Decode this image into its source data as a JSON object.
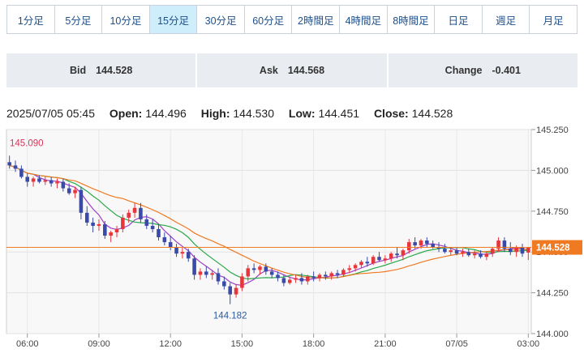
{
  "tabs": [
    {
      "label": "1分足",
      "active": false
    },
    {
      "label": "5分足",
      "active": false
    },
    {
      "label": "10分足",
      "active": false
    },
    {
      "label": "15分足",
      "active": true
    },
    {
      "label": "30分足",
      "active": false
    },
    {
      "label": "60分足",
      "active": false
    },
    {
      "label": "2時間足",
      "active": false
    },
    {
      "label": "4時間足",
      "active": false
    },
    {
      "label": "8時間足",
      "active": false
    },
    {
      "label": "日足",
      "active": false
    },
    {
      "label": "週足",
      "active": false
    },
    {
      "label": "月足",
      "active": false
    }
  ],
  "quote": {
    "bid_label": "Bid",
    "bid_value": "144.528",
    "ask_label": "Ask",
    "ask_value": "144.568",
    "change_label": "Change",
    "change_value": "-0.401"
  },
  "ohlc": {
    "datetime": "2025/07/05 05:45",
    "open_label": "Open:",
    "open": "144.496",
    "high_label": "High:",
    "high": "144.530",
    "low_label": "Low:",
    "low": "144.451",
    "close_label": "Close:",
    "close": "144.528"
  },
  "colors": {
    "up": "#e8353b",
    "down": "#3a4aa8",
    "ma_short": "#a03cc8",
    "ma_mid": "#2aa84a",
    "ma_long": "#f07a22",
    "price_line": "#f07a22",
    "high_label": "#d8335a",
    "low_label": "#2b5a9a"
  },
  "chart_data": {
    "type": "candlestick",
    "ylim": [
      144.0,
      145.25
    ],
    "y_ticks": [
      "145.250",
      "145.000",
      "144.750",
      "144.500",
      "144.250",
      "144.000"
    ],
    "x_ticks": [
      "06:00",
      "09:00",
      "12:00",
      "15:00",
      "18:00",
      "21:00",
      "07/05",
      "03:00"
    ],
    "high_annotation": "145.090",
    "low_annotation": "144.182",
    "current_price": "144.528",
    "grid": true,
    "ohlc": [
      [
        145.05,
        145.09,
        145.01,
        145.03
      ],
      [
        145.03,
        145.06,
        144.99,
        145.01
      ],
      [
        145.01,
        145.03,
        144.95,
        144.96
      ],
      [
        144.96,
        144.98,
        144.9,
        144.93
      ],
      [
        144.93,
        144.96,
        144.9,
        144.95
      ],
      [
        144.95,
        144.97,
        144.92,
        144.93
      ],
      [
        144.93,
        144.96,
        144.91,
        144.94
      ],
      [
        144.94,
        144.96,
        144.9,
        144.92
      ],
      [
        144.92,
        144.95,
        144.89,
        144.93
      ],
      [
        144.93,
        144.95,
        144.87,
        144.89
      ],
      [
        144.89,
        144.92,
        144.85,
        144.86
      ],
      [
        144.86,
        144.9,
        144.83,
        144.88
      ],
      [
        144.88,
        144.9,
        144.7,
        144.74
      ],
      [
        144.74,
        144.78,
        144.66,
        144.68
      ],
      [
        144.68,
        144.71,
        144.62,
        144.66
      ],
      [
        144.66,
        144.7,
        144.63,
        144.67
      ],
      [
        144.67,
        144.69,
        144.58,
        144.6
      ],
      [
        144.6,
        144.63,
        144.56,
        144.62
      ],
      [
        144.62,
        144.66,
        144.59,
        144.64
      ],
      [
        144.64,
        144.73,
        144.62,
        144.71
      ],
      [
        144.71,
        144.76,
        144.68,
        144.74
      ],
      [
        144.74,
        144.8,
        144.71,
        144.77
      ],
      [
        144.77,
        144.8,
        144.68,
        144.7
      ],
      [
        144.7,
        144.73,
        144.64,
        144.66
      ],
      [
        144.66,
        144.7,
        144.62,
        144.64
      ],
      [
        144.64,
        144.67,
        144.57,
        144.59
      ],
      [
        144.59,
        144.62,
        144.54,
        144.56
      ],
      [
        144.56,
        144.6,
        144.51,
        144.53
      ],
      [
        144.53,
        144.55,
        144.47,
        144.49
      ],
      [
        144.49,
        144.53,
        144.46,
        144.5
      ],
      [
        144.5,
        144.52,
        144.44,
        144.46
      ],
      [
        144.46,
        144.48,
        144.33,
        144.36
      ],
      [
        144.36,
        144.4,
        144.33,
        144.38
      ],
      [
        144.38,
        144.41,
        144.34,
        144.36
      ],
      [
        144.36,
        144.39,
        144.33,
        144.37
      ],
      [
        144.37,
        144.4,
        144.3,
        144.32
      ],
      [
        144.32,
        144.35,
        144.27,
        144.29
      ],
      [
        144.29,
        144.31,
        144.18,
        144.24
      ],
      [
        144.24,
        144.3,
        144.22,
        144.28
      ],
      [
        144.28,
        144.37,
        144.26,
        144.35
      ],
      [
        144.35,
        144.42,
        144.32,
        144.4
      ],
      [
        144.4,
        144.43,
        144.37,
        144.39
      ],
      [
        144.39,
        144.42,
        144.36,
        144.41
      ],
      [
        144.41,
        144.43,
        144.36,
        144.38
      ],
      [
        144.38,
        144.4,
        144.34,
        144.36
      ],
      [
        144.36,
        144.38,
        144.32,
        144.34
      ],
      [
        144.34,
        144.36,
        144.29,
        144.31
      ],
      [
        144.31,
        144.35,
        144.3,
        144.33
      ],
      [
        144.33,
        144.36,
        144.31,
        144.34
      ],
      [
        144.34,
        144.37,
        144.3,
        144.32
      ],
      [
        144.32,
        144.36,
        144.3,
        144.35
      ],
      [
        144.35,
        144.38,
        144.32,
        144.34
      ],
      [
        144.34,
        144.37,
        144.32,
        144.36
      ],
      [
        144.36,
        144.38,
        144.33,
        144.35
      ],
      [
        144.35,
        144.38,
        144.33,
        144.37
      ],
      [
        144.37,
        144.39,
        144.34,
        144.36
      ],
      [
        144.36,
        144.4,
        144.35,
        144.39
      ],
      [
        144.39,
        144.42,
        144.37,
        144.4
      ],
      [
        144.4,
        144.43,
        144.38,
        144.42
      ],
      [
        144.42,
        144.45,
        144.4,
        144.44
      ],
      [
        144.44,
        144.47,
        144.41,
        144.43
      ],
      [
        144.43,
        144.48,
        144.42,
        144.47
      ],
      [
        144.47,
        144.5,
        144.44,
        144.45
      ],
      [
        144.45,
        144.48,
        144.43,
        144.46
      ],
      [
        144.46,
        144.5,
        144.44,
        144.49
      ],
      [
        144.49,
        144.53,
        144.46,
        144.48
      ],
      [
        144.48,
        144.52,
        144.45,
        144.51
      ],
      [
        144.51,
        144.58,
        144.49,
        144.56
      ],
      [
        144.56,
        144.59,
        144.52,
        144.54
      ],
      [
        144.54,
        144.58,
        144.52,
        144.57
      ],
      [
        144.57,
        144.59,
        144.53,
        144.55
      ],
      [
        144.55,
        144.57,
        144.52,
        144.53
      ],
      [
        144.53,
        144.56,
        144.5,
        144.52
      ],
      [
        144.52,
        144.55,
        144.49,
        144.5
      ],
      [
        144.5,
        144.53,
        144.48,
        144.51
      ],
      [
        144.51,
        144.53,
        144.48,
        144.49
      ],
      [
        144.49,
        144.52,
        144.47,
        144.5
      ],
      [
        144.5,
        144.52,
        144.47,
        144.48
      ],
      [
        144.48,
        144.51,
        144.46,
        144.49
      ],
      [
        144.49,
        144.51,
        144.46,
        144.47
      ],
      [
        144.47,
        144.5,
        144.45,
        144.49
      ],
      [
        144.49,
        144.53,
        144.47,
        144.52
      ],
      [
        144.52,
        144.59,
        144.5,
        144.57
      ],
      [
        144.57,
        144.59,
        144.5,
        144.52
      ],
      [
        144.52,
        144.56,
        144.48,
        144.5
      ],
      [
        144.5,
        144.54,
        144.47,
        144.53
      ],
      [
        144.53,
        144.55,
        144.47,
        144.49
      ],
      [
        144.496,
        144.53,
        144.451,
        144.528
      ]
    ]
  }
}
